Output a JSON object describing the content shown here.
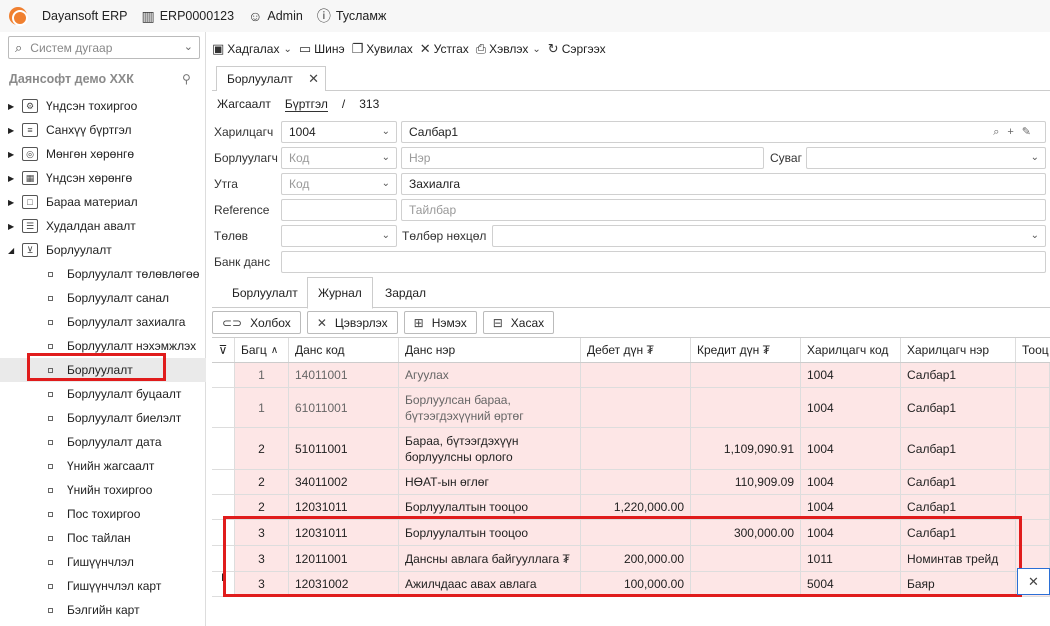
{
  "topbar": {
    "app_name": "Dayansoft ERP",
    "company_code": "ERP0000123",
    "user": "Admin",
    "help": "Тусламж"
  },
  "sidebar": {
    "search_placeholder": "Систем дугаар",
    "company": "Даянсофт демо ХХК",
    "items": [
      {
        "label": "Үндсэн тохиргоо",
        "icon": "gear-icon"
      },
      {
        "label": "Санхүү бүртгэл",
        "icon": "ledger-icon"
      },
      {
        "label": "Мөнгөн хөрөнгө",
        "icon": "money-icon"
      },
      {
        "label": "Үндсэн хөрөнгө",
        "icon": "building-icon"
      },
      {
        "label": "Бараа материал",
        "icon": "box-icon"
      },
      {
        "label": "Худалдан авалт",
        "icon": "purchase-icon"
      },
      {
        "label": "Борлуулалт",
        "icon": "cart-icon"
      }
    ],
    "sub_items": [
      "Борлуулалт төлөвлөгөө",
      "Борлуулалт санал",
      "Борлуулалт захиалга",
      "Борлуулалт нэхэмжлэх",
      "Борлуулалт",
      "Борлуулалт буцаалт",
      "Борлуулалт биелэлт",
      "Борлуулалт дата",
      "Үнийн жагсаалт",
      "Үнийн тохиргоо",
      "Пос тохиргоо",
      "Пос тайлан",
      "Гишүүнчлэл",
      "Гишүүнчлэл карт",
      "Бэлгийн карт"
    ]
  },
  "toolbar": {
    "save": "Хадгалах",
    "new": "Шинэ",
    "copy": "Хувилах",
    "delete": "Устгах",
    "print": "Хэвлэх",
    "refresh": "Сэргээх"
  },
  "doc_tab": "Борлуулалт",
  "breadcrumb": {
    "list": "Жагсаалт",
    "register": "Бүртгэл",
    "sep": "/",
    "id": "313"
  },
  "form": {
    "customer_label": "Харилцагч",
    "customer_code": "1004",
    "customer_name": "Салбар1",
    "seller_label": "Борлуулагч",
    "seller_code_ph": "Код",
    "seller_name_ph": "Нэр",
    "channel_label": "Суваг",
    "type_label": "Утга",
    "type_code_ph": "Код",
    "type_value": "Захиалга",
    "reference_label": "Reference",
    "reference_desc_ph": "Тайлбар",
    "payment_label": "Төлөв",
    "payment_terms_label": "Төлбөр нөхцөл",
    "bank_label": "Банк данс"
  },
  "subtabs": [
    "Борлуулалт",
    "Журнал",
    "Зардал"
  ],
  "grid_toolbar": {
    "link": "Холбох",
    "unlink": "Цэвэрлэх",
    "add": "Нэмэх",
    "remove": "Хасах"
  },
  "grid": {
    "columns": [
      "Багц",
      "Данс код",
      "Данс нэр",
      "Дебет дүн ₮",
      "Кредит дүн ₮",
      "Харилцагч код",
      "Харилцагч нэр",
      "Тооц"
    ],
    "rows": [
      {
        "batch": "1",
        "acc_code": "14011001",
        "acc_name": "Агуулах",
        "debit": "",
        "credit": "",
        "cust_code": "1004",
        "cust_name": "Салбар1"
      },
      {
        "batch": "1",
        "acc_code": "61011001",
        "acc_name": "Борлуулсан бараа, бүтээгдэхүүний өртөг",
        "debit": "",
        "credit": "",
        "cust_code": "1004",
        "cust_name": "Салбар1"
      },
      {
        "batch": "2",
        "acc_code": "51011001",
        "acc_name": "Бараа, бүтээгдэхүүн борлуулсны орлого",
        "debit": "",
        "credit": "1,109,090.91",
        "cust_code": "1004",
        "cust_name": "Салбар1"
      },
      {
        "batch": "2",
        "acc_code": "34011002",
        "acc_name": "НӨАТ-ын өглөг",
        "debit": "",
        "credit": "110,909.09",
        "cust_code": "1004",
        "cust_name": "Салбар1"
      },
      {
        "batch": "2",
        "acc_code": "12031011",
        "acc_name": "Борлуулалтын тооцоо",
        "debit": "1,220,000.00",
        "credit": "",
        "cust_code": "1004",
        "cust_name": "Салбар1"
      },
      {
        "batch": "3",
        "acc_code": "12031011",
        "acc_name": "Борлуулалтын тооцоо",
        "debit": "",
        "credit": "300,000.00",
        "cust_code": "1004",
        "cust_name": "Салбар1"
      },
      {
        "batch": "3",
        "acc_code": "12011001",
        "acc_name": "Дансны авлага байгууллага ₮",
        "debit": "200,000.00",
        "credit": "",
        "cust_code": "1011",
        "cust_name": "Номинтав трейд"
      },
      {
        "batch": "3",
        "acc_code": "12031002",
        "acc_name": "Ажилчдаас авах авлага",
        "debit": "100,000.00",
        "credit": "",
        "cust_code": "5004",
        "cust_name": "Баяр"
      }
    ]
  }
}
